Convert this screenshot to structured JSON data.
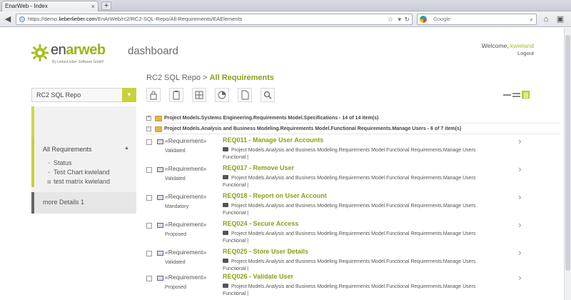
{
  "browser": {
    "tab_title": "EnarWeb - Index",
    "tab_close": "×",
    "new_tab": "+",
    "url_prefix": "https://demo.",
    "url_domain": "lieberlieber.com",
    "url_rest": "/EnArWeb/rc2/RC2-SQL-Repo/All-Requirements/EAElements",
    "search_placeholder": "Google"
  },
  "header": {
    "logo_enar": "en",
    "logo_ar": "ar",
    "logo_web": "web",
    "logo_sub": "By LieberLieber Software GmbH",
    "app_title": "dashboard",
    "welcome_text": "Welcome, ",
    "welcome_user": "kwieland",
    "logout": "Logout"
  },
  "breadcrumb": {
    "repo": "RC2 SQL Repo",
    "sep": " > ",
    "current": "All Requirements"
  },
  "repo_select": {
    "value": "RC2 SQL Repo"
  },
  "toolbar": {
    "icons": [
      "lock-icon",
      "clipboard-icon",
      "table-icon",
      "pie-chart-icon",
      "document-icon",
      "search-icon"
    ]
  },
  "sidebar": {
    "section": "All Requirements",
    "items": [
      {
        "label": "Status",
        "icon": "pie-icon"
      },
      {
        "label": "Test Chart kwieland",
        "icon": "pie-icon"
      },
      {
        "label": "test matrix kwieland",
        "icon": "matrix-icon"
      }
    ],
    "more": "more Details 1"
  },
  "folders": [
    {
      "text": "Project Models.Systems Engineering.Requirements Model.Specifications - 14 of 14 item(s)"
    },
    {
      "text": "Project Models.Analysis and Business Modeling.Requirements Model.Functional Requirements.Manage Users - 6 of 7 item(s)"
    }
  ],
  "requirements": [
    {
      "stereotype": "«Requirement»",
      "title": "REQ011 - Manage User Accounts",
      "status": "Validated",
      "path": "Project Models.Analysis and Business Modeling.Requirements Model.Functional Requirements.Manage Users",
      "path2": "Functional |"
    },
    {
      "stereotype": "«Requirement»",
      "title": "REQ017 - Remove User",
      "status": "Validated",
      "path": "Project Models.Analysis and Business Modeling.Requirements Model.Functional Requirements.Manage Users",
      "path2": "Functional |"
    },
    {
      "stereotype": "«Requirement»",
      "title": "REQ018 - Report on User Account",
      "status": "Mandatory",
      "path": "Project Models.Analysis and Business Modeling.Requirements Model.Functional Requirements.Manage Users",
      "path2": "Functional |"
    },
    {
      "stereotype": "«Requirement»",
      "title": "REQ024 - Secure Access",
      "status": "Proposed",
      "path": "Project Models.Analysis and Business Modeling.Requirements Model.Functional Requirements.Manage Users",
      "path2": "Functional |"
    },
    {
      "stereotype": "«Requirement»",
      "title": "REQ025 - Store User Details",
      "status": "Validated",
      "path": "Project Models.Analysis and Business Modeling.Requirements Model.Functional Requirements.Manage Users",
      "path2": "Functional |"
    },
    {
      "stereotype": "«Requirement»",
      "title": "REQ026 - Validate User",
      "status": "Proposed",
      "path": "Project Models.Analysis and Business Modeling.Requirements Model.Functional Requirements.Manage Users",
      "path2": "Functional |"
    }
  ],
  "colors": {
    "accent": "#8aa01a",
    "accent_light": "#c5d33a"
  }
}
